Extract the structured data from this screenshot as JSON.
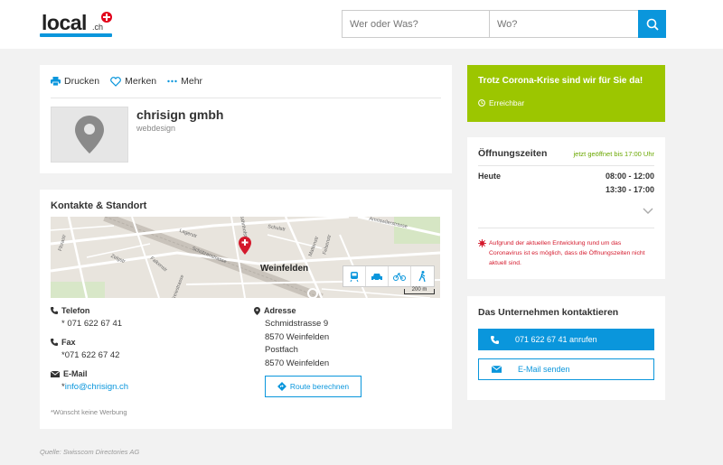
{
  "header": {
    "logo_text": "local",
    "logo_suffix": ".ch",
    "search_what_placeholder": "Wer oder Was?",
    "search_where_placeholder": "Wo?"
  },
  "toolbar": {
    "print_label": "Drucken",
    "save_label": "Merken",
    "more_label": "Mehr"
  },
  "company": {
    "name": "chrisign gmbh",
    "category": "webdesign"
  },
  "contact": {
    "section_title": "Kontakte & Standort",
    "phone_label": "Telefon",
    "phone_value": "*  071 622 67 41",
    "fax_label": "Fax",
    "fax_value": "*071 622 67 42",
    "email_label": "E-Mail",
    "email_prefix": "*",
    "email_value": "info@chrisign.ch",
    "address_label": "Adresse",
    "address_lines": [
      "Schmidstrasse 9",
      "8570 Weinfelden",
      "Postfach",
      "8570 Weinfelden"
    ],
    "route_label": "Route berechnen",
    "no_ads_note": "*Wünscht keine Werbung"
  },
  "map": {
    "city": "Weinfelden",
    "scale": "200 m",
    "street_labels": [
      "Amriswilerstrasse",
      "Schulstr",
      "Bahnhofstrasse",
      "Lagerstr",
      "Schützenstrasse",
      "Falkenstr",
      "Freiestrasse",
      "Zelgstr",
      "Mattenstr",
      "Felsenstr",
      "Florastr"
    ]
  },
  "banner": {
    "title": "Trotz Corona-Krise sind wir für Sie da!",
    "link": "Erreichbar"
  },
  "hours": {
    "title": "Öffnungszeiten",
    "status": "jetzt geöffnet bis 17:00 Uhr",
    "day": "Heute",
    "slot1": "08:00 - 12:00",
    "slot2": "13:30 - 17:00",
    "corona_note": "Aufgrund der aktuellen Entwicklung rund um das Coronavirus ist es möglich, dass die Öffnungszeiten nicht aktuell sind."
  },
  "cta": {
    "title": "Das Unternehmen kontaktieren",
    "call_label": "071 622 67 41 anrufen",
    "mail_label": "E-Mail senden"
  },
  "footer": {
    "source": "Quelle: Swisscom Directories AG"
  },
  "colors": {
    "accent": "#0a96dc",
    "banner": "#9cc600",
    "alert": "#d4192c",
    "open_status": "#6aa700"
  }
}
